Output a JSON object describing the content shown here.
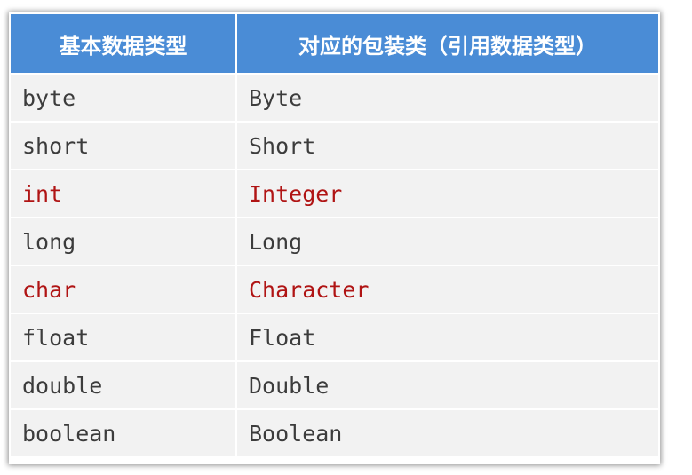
{
  "table": {
    "headers": [
      "基本数据类型",
      "对应的包装类（引用数据类型）"
    ],
    "highlight_color": "#b01414",
    "header_color": "#4a8cd6",
    "rows": [
      {
        "primitive": "byte",
        "wrapper": "Byte",
        "highlight": false
      },
      {
        "primitive": "short",
        "wrapper": "Short",
        "highlight": false
      },
      {
        "primitive": "int",
        "wrapper": "Integer",
        "highlight": true
      },
      {
        "primitive": "long",
        "wrapper": "Long",
        "highlight": false
      },
      {
        "primitive": "char",
        "wrapper": "Character",
        "highlight": true
      },
      {
        "primitive": "float",
        "wrapper": "Float",
        "highlight": false
      },
      {
        "primitive": "double",
        "wrapper": "Double",
        "highlight": false
      },
      {
        "primitive": "boolean",
        "wrapper": "Boolean",
        "highlight": false
      }
    ]
  }
}
